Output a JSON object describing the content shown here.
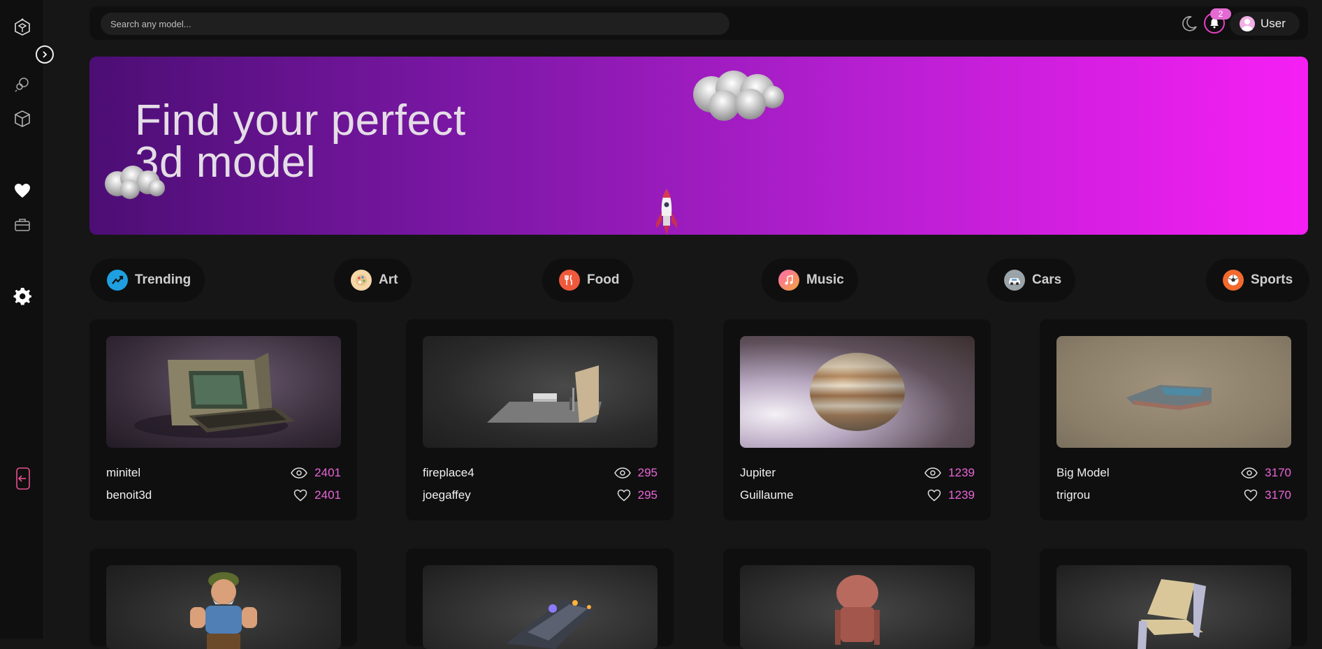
{
  "search": {
    "placeholder": "Search any model..."
  },
  "header": {
    "notification_count": "2",
    "user_name": "User"
  },
  "hero": {
    "title_line1": "Find your perfect",
    "title_line2": "3d model"
  },
  "categories": [
    {
      "label": "Trending",
      "color": "#1e9fe0"
    },
    {
      "label": "Art",
      "color": "#f5d7a8"
    },
    {
      "label": "Food",
      "color": "#ef5a3c"
    },
    {
      "label": "Music",
      "color": "#ff7ac0"
    },
    {
      "label": "Cars",
      "color": "#9aa3a8"
    },
    {
      "label": "Sports",
      "color": "#f26a2e"
    }
  ],
  "models": [
    {
      "title": "minitel",
      "author": "benoit3d",
      "views": "2401",
      "likes": "2401"
    },
    {
      "title": "fireplace4",
      "author": "joegaffey",
      "views": "295",
      "likes": "295"
    },
    {
      "title": "Jupiter",
      "author": "Guillaume",
      "views": "1239",
      "likes": "1239"
    },
    {
      "title": "Big Model",
      "author": "trigrou",
      "views": "3170",
      "likes": "3170"
    }
  ],
  "colors": {
    "accent": "#e865d8",
    "bg": "#161616",
    "panel": "#0f0f0f"
  }
}
